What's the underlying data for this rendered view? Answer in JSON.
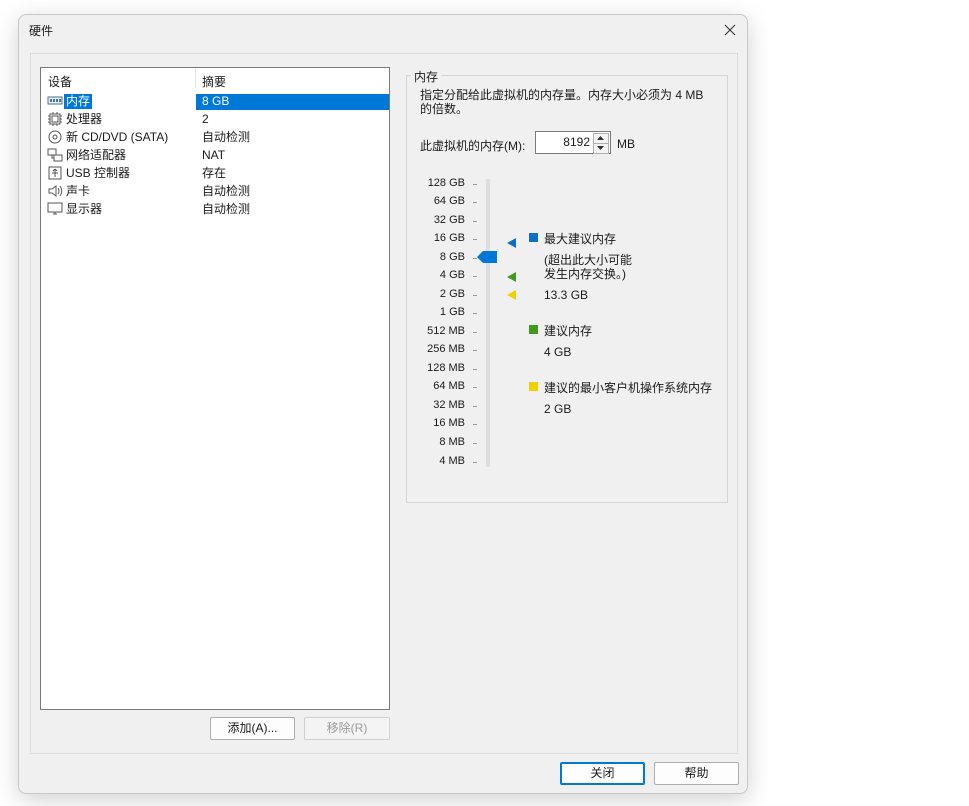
{
  "dialog": {
    "title": "硬件",
    "add_button": "添加(A)...",
    "remove_button": "移除(R)",
    "close_button": "关闭",
    "help_button": "帮助"
  },
  "device_list": {
    "header_device": "设备",
    "header_summary": "摘要",
    "items": [
      {
        "name": "内存",
        "summary": "8 GB",
        "icon": "memory-icon",
        "selected": true
      },
      {
        "name": "处理器",
        "summary": "2",
        "icon": "processor-icon"
      },
      {
        "name": "新 CD/DVD (SATA)",
        "summary": "自动检测",
        "icon": "cd-dvd-icon"
      },
      {
        "name": "网络适配器",
        "summary": "NAT",
        "icon": "network-adapter-icon"
      },
      {
        "name": "USB 控制器",
        "summary": "存在",
        "icon": "usb-icon"
      },
      {
        "name": "声卡",
        "summary": "自动检测",
        "icon": "speaker-icon"
      },
      {
        "name": "显示器",
        "summary": "自动检测",
        "icon": "monitor-icon"
      }
    ]
  },
  "memory_panel": {
    "group_title": "内存",
    "description_line1": "指定分配给此虚拟机的内存量。内存大小必须为 4 MB",
    "description_line2": "的倍数。",
    "memory_label": "此虚拟机的内存(M):",
    "memory_value": "8192",
    "memory_unit": "MB",
    "scale_labels": [
      "128 GB",
      "64 GB",
      "32 GB",
      "16 GB",
      "8 GB",
      "4 GB",
      "2 GB",
      "1 GB",
      "512 MB",
      "256 MB",
      "128 MB",
      "64 MB",
      "32 MB",
      "16 MB",
      "8 MB",
      "4 MB"
    ],
    "current_level": "8 GB",
    "legend": {
      "max_title": "最大建议内存",
      "max_note_line1": "(超出此大小可能",
      "max_note_line2": "发生内存交换。)",
      "max_value": "13.3 GB",
      "rec_title": "建议内存",
      "rec_value": "4 GB",
      "min_title": "建议的最小客户机操作系统内存",
      "min_value": "2 GB"
    }
  },
  "colors": {
    "selection": "#0078d7",
    "max_marker": "#0f6fc6",
    "recommended_marker": "#3f9a1e",
    "minimum_marker": "#f0d000"
  }
}
